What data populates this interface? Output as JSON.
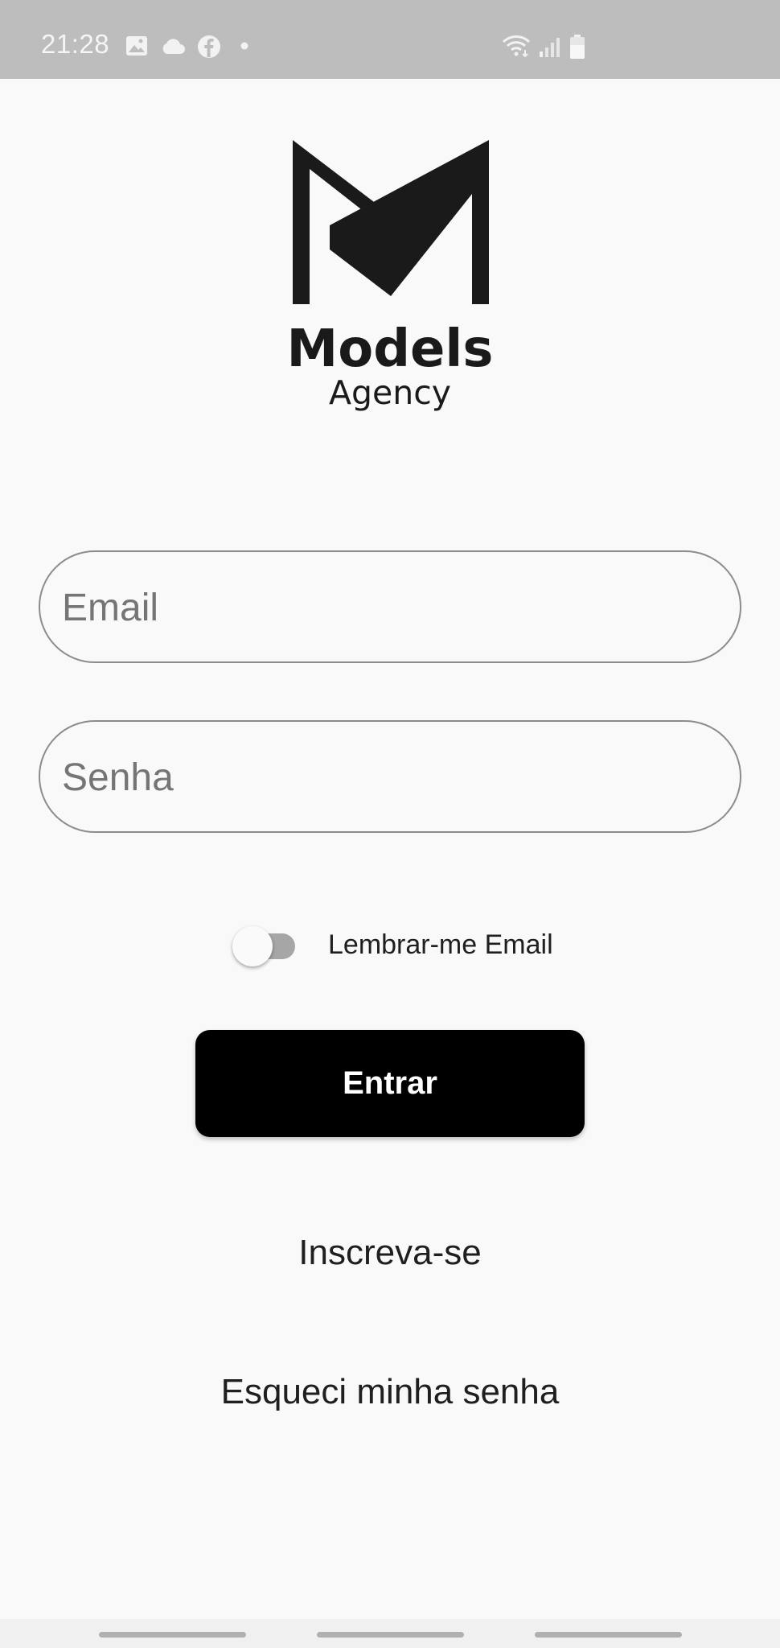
{
  "status_bar": {
    "time": "21:28",
    "left_icons": [
      "image-icon",
      "cloud-icon",
      "facebook-icon",
      "dot-icon"
    ],
    "right_icons": [
      "wifi-icon",
      "signal-icon",
      "battery-icon"
    ]
  },
  "logo": {
    "brand_line1": "Models",
    "brand_line2": "Agency"
  },
  "form": {
    "email_placeholder": "Email",
    "password_placeholder": "Senha",
    "remember_label": "Lembrar-me Email",
    "remember_enabled": false,
    "submit_label": "Entrar"
  },
  "links": {
    "signup": "Inscreva-se",
    "forgot_password": "Esqueci minha senha"
  },
  "colors": {
    "background": "#f9f9f9",
    "status_bar": "#bdbdbd",
    "button": "#000000",
    "button_text": "#ffffff",
    "field_border": "#8c8c8c",
    "placeholder": "#757575"
  }
}
